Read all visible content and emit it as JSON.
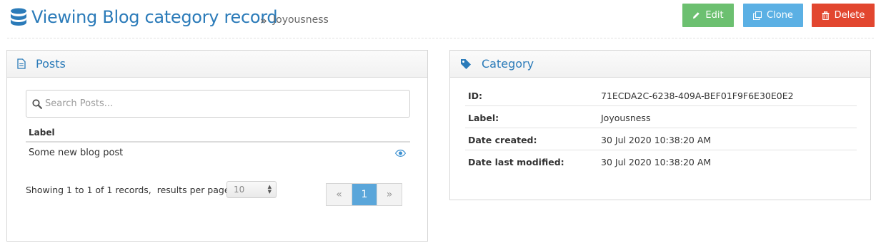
{
  "header": {
    "title": "Viewing Blog category record",
    "breadcrumb_sep": "»",
    "breadcrumb": "Joyousness",
    "actions": {
      "edit": "Edit",
      "clone": "Clone",
      "delete": "Delete"
    }
  },
  "posts_panel": {
    "title": "Posts",
    "search_placeholder": "Search Posts...",
    "column_label": "Label",
    "rows": [
      {
        "label": "Some new blog post"
      }
    ],
    "showing_text": "Showing 1 to 1 of 1 records,  results per page:",
    "per_page_value": "10",
    "pager": {
      "prev": "«",
      "current": "1",
      "next": "»"
    }
  },
  "category_panel": {
    "title": "Category",
    "fields": [
      {
        "key": "ID:",
        "value": "71ECDA2C-6238-409A-BEF01F9F6E30E0E2"
      },
      {
        "key": "Label:",
        "value": "Joyousness"
      },
      {
        "key": "Date created:",
        "value": "30 Jul 2020 10:38:20 AM"
      },
      {
        "key": "Date last modified:",
        "value": "30 Jul 2020 10:38:20 AM"
      }
    ]
  },
  "colors": {
    "title_blue": "#2b7bb9",
    "edit_green": "#6cc070",
    "clone_blue": "#5bb0e4",
    "delete_red": "#e2462f",
    "pager_active": "#5aa6da"
  },
  "icons": {
    "title": "database-icon",
    "edit": "pencil-icon",
    "clone": "copy-icon",
    "delete": "trash-icon",
    "posts": "document-icon",
    "category": "tag-icon",
    "search": "search-icon",
    "row_action": "eye-icon"
  }
}
